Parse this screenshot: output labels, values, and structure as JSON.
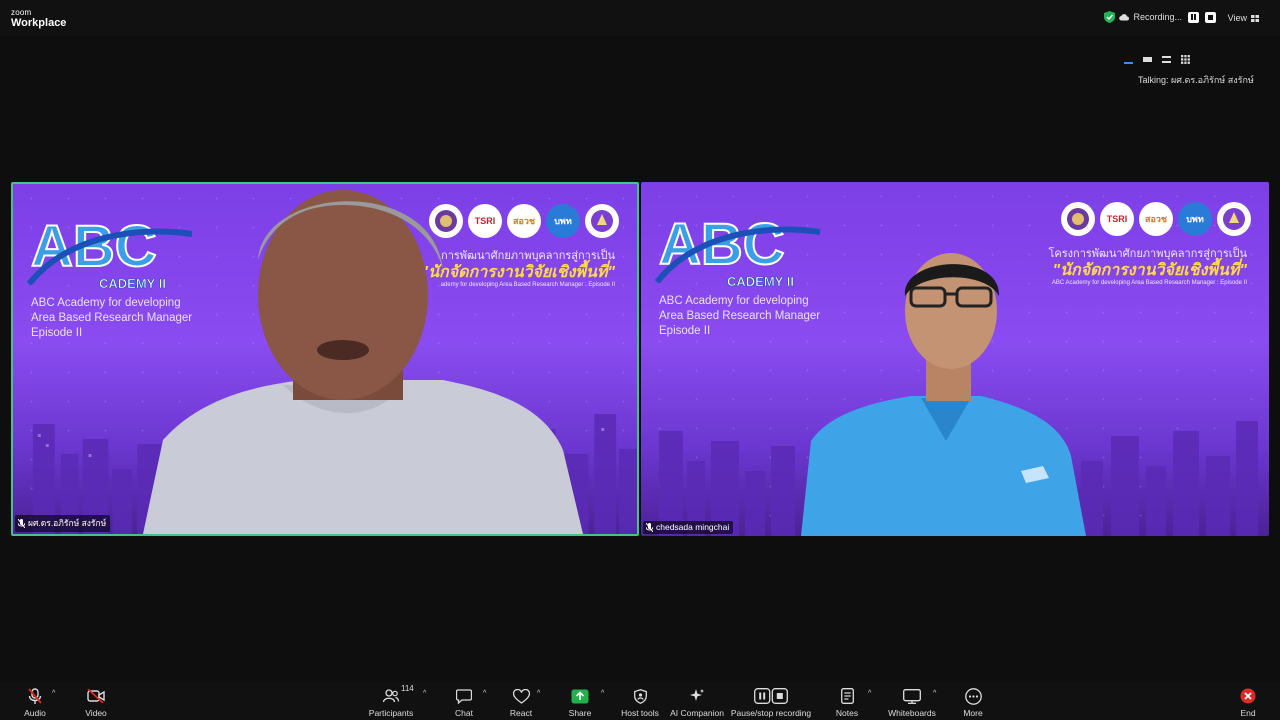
{
  "app": {
    "brand_small": "zoom",
    "brand_big": "Workplace"
  },
  "topbar": {
    "recording": "Recording...",
    "view": "View"
  },
  "talking": "Talking: ผศ.ดร.อภิรักษ์ สงรักษ์",
  "tiles": [
    {
      "name": "ผศ.ดร.อภิรักษ์ สงรักษ์",
      "slide": {
        "subtitle": [
          "ABC Academy for developing",
          "Area Based Research Manager",
          "Episode II"
        ],
        "thai_line1": "การพัฒนาศักยภาพบุคลากรสู่การเป็น",
        "thai_line2": "\"นักจัดการงานวิจัยเชิงพื้นที่\"",
        "thai_line3": "ademy for developing Area Based Research Manager : Episode II"
      }
    },
    {
      "name": "chedsada mingchai",
      "slide": {
        "subtitle": [
          "ABC Academy for developing",
          "Area Based Research Manager",
          "Episode II"
        ],
        "thai_line1": "โครงการพัฒนาศักยภาพบุคลากรสู่การเป็น",
        "thai_line2": "\"นักจัดการงานวิจัยเชิงพื้นที่\"",
        "thai_line3": "ABC Academy for developing Area Based Research Manager : Episode II"
      }
    }
  ],
  "logo_labels": [
    "TSRI",
    "สอวช",
    "บพท"
  ],
  "toolbar": {
    "audio": "Audio",
    "video": "Video",
    "participants": "Participants",
    "participants_count": "114",
    "chat": "Chat",
    "react": "React",
    "share": "Share",
    "host_tools": "Host tools",
    "ai_companion": "AI Companion",
    "pause_recording": "Pause/stop recording",
    "notes": "Notes",
    "whiteboards": "Whiteboards",
    "more": "More",
    "end": "End"
  },
  "colors": {
    "active_speaker": "#4ac08a",
    "slide_purple": "#7d3fe6",
    "share_green": "#22b14c",
    "end_red": "#e02828",
    "headline_yellow": "#ffd84a"
  }
}
